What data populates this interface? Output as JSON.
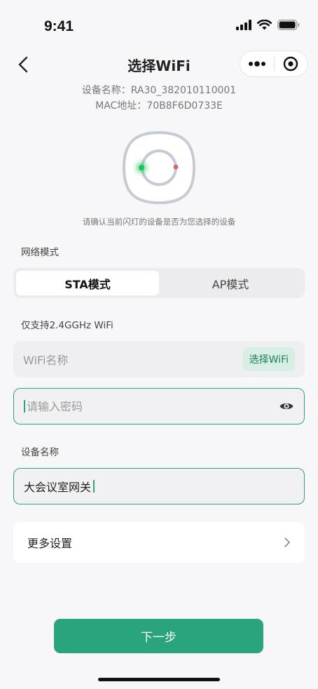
{
  "status_bar": {
    "time": "9:41"
  },
  "nav": {
    "title": "选择WiFi"
  },
  "device_info": {
    "name_line": "设备名称：RA30_382010110001",
    "mac_line": "MAC地址：70B8F6D0733E"
  },
  "confirm_text": "请确认当前闪灯的设备是否为您选择的设备",
  "network_mode": {
    "label": "网络模式",
    "options": [
      "STA模式",
      "AP模式"
    ],
    "selected": "STA模式"
  },
  "wifi": {
    "support_label": "仅支持2.4GGHz WiFi",
    "name_placeholder": "WiFi名称",
    "select_button": "选择WiFi",
    "password_placeholder": "请输入密码"
  },
  "device_name": {
    "label": "设备名称",
    "value": "大会议室网关"
  },
  "more_settings": {
    "label": "更多设置"
  },
  "next_button": "下一步",
  "colors": {
    "accent": "#2aa47d",
    "accent_light": "#d7eee3",
    "led_green": "#1fc35c",
    "led_red": "#d96565"
  },
  "icons": [
    "signal-icon",
    "wifi-icon",
    "battery-icon",
    "back-arrow-icon",
    "more-dots-icon",
    "target-icon",
    "eye-icon",
    "chevron-right-icon"
  ]
}
